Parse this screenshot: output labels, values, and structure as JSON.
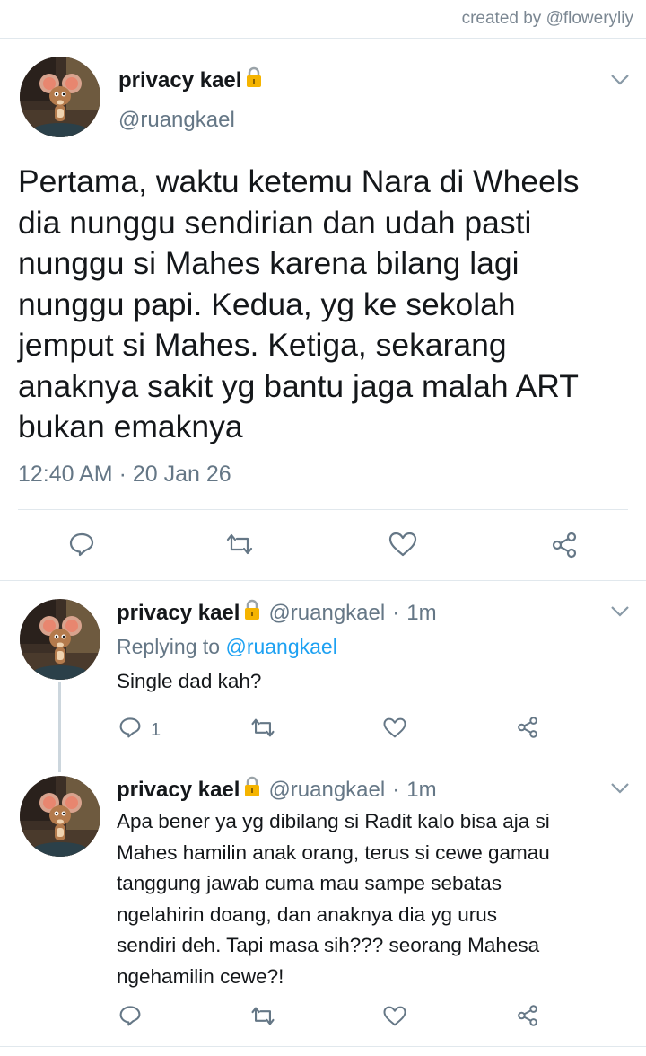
{
  "credit": "created by @floweryliy",
  "main_tweet": {
    "name": "privacy kael",
    "handle": "@ruangkael",
    "lines": [
      "Pertama, waktu ketemu Nara di Wheels",
      "dia nunggu sendirian dan udah pasti",
      "nunggu si Mahes karena bilang lagi",
      "nunggu papi. Kedua, yg ke sekolah",
      "jemput si Mahes. Ketiga, sekarang",
      "anaknya sakit yg bantu jaga malah ART",
      "bukan emaknya"
    ],
    "time": "12:40 AM",
    "date": "20 Jan 26"
  },
  "replies": [
    {
      "name": "privacy kael",
      "handle": "@ruangkael",
      "dot": "·",
      "time": "1m",
      "replying_prefix": "Replying to",
      "replying_handle": "@ruangkael",
      "lines": [
        "Single dad kah?"
      ],
      "reply_count": "1"
    },
    {
      "name": "privacy kael",
      "handle": "@ruangkael",
      "dot": "·",
      "time": "1m",
      "lines": [
        "Apa bener ya yg dibilang si Radit kalo bisa aja si",
        "Mahes hamilin anak orang, terus si cewe gamau",
        "tanggung jawab cuma mau sampe sebatas",
        "ngelahirin doang, dan anaknya dia yg urus",
        "sendiri deh. Tapi masa sih??? seorang Mahesa",
        "ngehamilin cewe?!"
      ],
      "reply_count": ""
    }
  ],
  "colors": {
    "text": "#14171a",
    "muted": "#657786",
    "link": "#1da1f2",
    "divider": "#e1e8ed",
    "lock": "#f5b400"
  },
  "icons": {
    "lock": "lock-icon",
    "reply": "reply-icon",
    "retweet": "retweet-icon",
    "like": "heart-icon",
    "share": "share-icon",
    "caret": "chevron-down-icon"
  }
}
